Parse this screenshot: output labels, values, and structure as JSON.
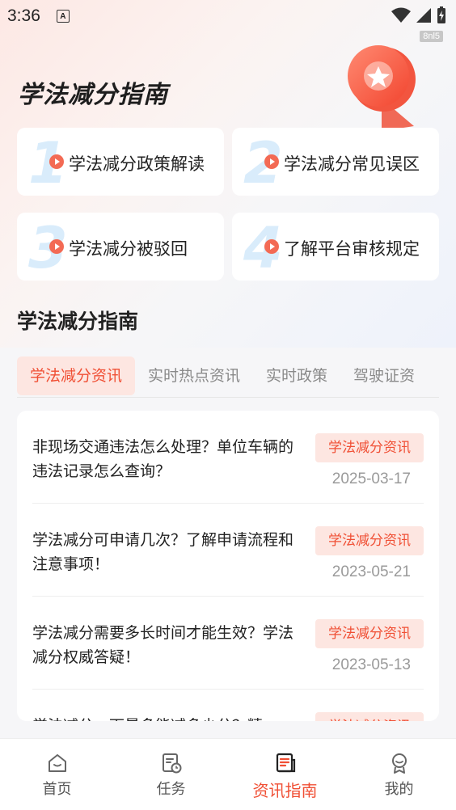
{
  "status": {
    "time": "3:36",
    "notice_icon": "A",
    "badge": "8nl5"
  },
  "hero": {
    "title": "学法减分指南"
  },
  "guide_cards": [
    {
      "number": "1",
      "label": "学法减分政策解读"
    },
    {
      "number": "2",
      "label": "学法减分常见误区"
    },
    {
      "number": "3",
      "label": "学法减分被驳回"
    },
    {
      "number": "4",
      "label": "了解平台审核规定"
    }
  ],
  "section": {
    "title": "学法减分指南"
  },
  "tabs": [
    "学法减分资讯",
    "实时热点资讯",
    "实时政策",
    "驾驶证资"
  ],
  "articles": [
    {
      "title": "非现场交通违法怎么处理？单位车辆的违法记录怎么查询？",
      "tag": "学法减分资讯",
      "date": "2025-03-17"
    },
    {
      "title": "学法减分可申请几次？了解申请流程和注意事项！",
      "tag": "学法减分资讯",
      "date": "2023-05-21"
    },
    {
      "title": "学法减分需要多长时间才能生效？学法减分权威答疑！",
      "tag": "学法减分资讯",
      "date": "2023-05-13"
    },
    {
      "title": "学法减分一下最多能减多少分？精",
      "tag": "学法减分资讯",
      "date": ""
    }
  ],
  "tabbar": [
    {
      "label": "首页",
      "icon": "home-icon"
    },
    {
      "label": "任务",
      "icon": "task-icon"
    },
    {
      "label": "资讯指南",
      "icon": "news-icon"
    },
    {
      "label": "我的",
      "icon": "profile-icon"
    }
  ],
  "colors": {
    "accent": "#f04f34",
    "chip_bg": "#fde6e1",
    "card_number": "#d9ecfb"
  }
}
